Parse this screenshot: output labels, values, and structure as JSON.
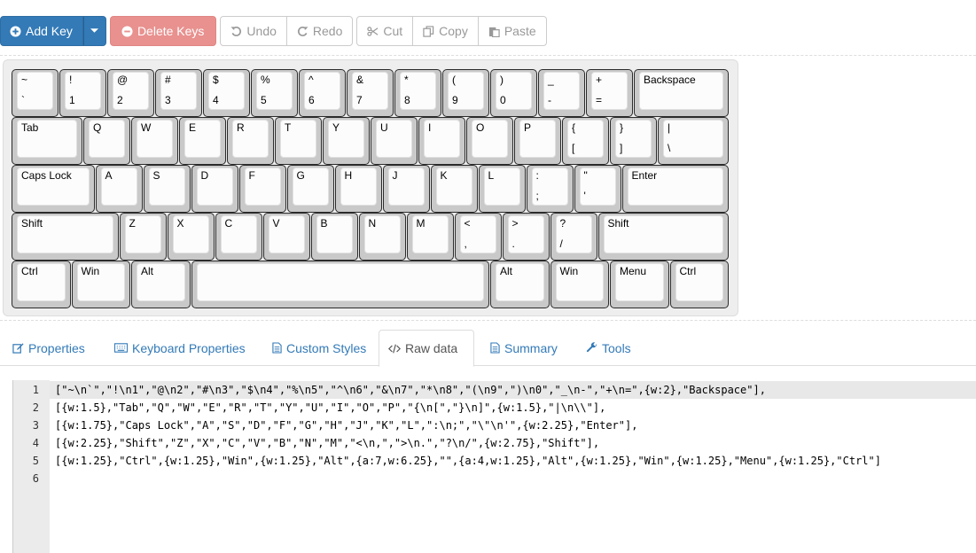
{
  "toolbar": {
    "add_key": "Add Key",
    "delete_keys": "Delete Keys",
    "undo": "Undo",
    "redo": "Redo",
    "cut": "Cut",
    "copy": "Copy",
    "paste": "Paste"
  },
  "keyboard": {
    "rows": [
      [
        [
          "~",
          "`"
        ],
        [
          "!",
          "1"
        ],
        [
          "@",
          "2"
        ],
        [
          "#",
          "3"
        ],
        [
          "$",
          "4"
        ],
        [
          "%",
          "5"
        ],
        [
          "^",
          "6"
        ],
        [
          "&",
          "7"
        ],
        [
          "*",
          "8"
        ],
        [
          "(",
          "9"
        ],
        [
          ")",
          "0"
        ],
        [
          "_",
          "-"
        ],
        [
          "+",
          "="
        ],
        [
          "Backspace",
          ""
        ]
      ],
      [
        [
          "Tab",
          ""
        ],
        [
          "Q",
          ""
        ],
        [
          "W",
          ""
        ],
        [
          "E",
          ""
        ],
        [
          "R",
          ""
        ],
        [
          "T",
          ""
        ],
        [
          "Y",
          ""
        ],
        [
          "U",
          ""
        ],
        [
          "I",
          ""
        ],
        [
          "O",
          ""
        ],
        [
          "P",
          ""
        ],
        [
          "{",
          "["
        ],
        [
          "}",
          "]"
        ],
        [
          "|",
          "\\"
        ]
      ],
      [
        [
          "Caps Lock",
          ""
        ],
        [
          "A",
          ""
        ],
        [
          "S",
          ""
        ],
        [
          "D",
          ""
        ],
        [
          "F",
          ""
        ],
        [
          "G",
          ""
        ],
        [
          "H",
          ""
        ],
        [
          "J",
          ""
        ],
        [
          "K",
          ""
        ],
        [
          "L",
          ""
        ],
        [
          ":",
          ";"
        ],
        [
          "\"",
          "'"
        ],
        [
          "Enter",
          ""
        ]
      ],
      [
        [
          "Shift",
          ""
        ],
        [
          "Z",
          ""
        ],
        [
          "X",
          ""
        ],
        [
          "C",
          ""
        ],
        [
          "V",
          ""
        ],
        [
          "B",
          ""
        ],
        [
          "N",
          ""
        ],
        [
          "M",
          ""
        ],
        [
          "<",
          ","
        ],
        [
          ">",
          "."
        ],
        [
          "?",
          "/"
        ],
        [
          "Shift",
          ""
        ]
      ],
      [
        [
          "Ctrl",
          ""
        ],
        [
          "Win",
          ""
        ],
        [
          "Alt",
          ""
        ],
        [
          "",
          ""
        ],
        [
          "Alt",
          ""
        ],
        [
          "Win",
          ""
        ],
        [
          "Menu",
          ""
        ],
        [
          "Ctrl",
          ""
        ]
      ]
    ]
  },
  "tabs": {
    "properties": "Properties",
    "keyboard_properties": "Keyboard Properties",
    "custom_styles": "Custom Styles",
    "raw_data": "Raw data",
    "summary": "Summary",
    "tools": "Tools"
  },
  "editor": {
    "line_numbers": [
      "1",
      "2",
      "3",
      "4",
      "5",
      "6"
    ],
    "lines": [
      "[\"~\\n`\",\"!\\n1\",\"@\\n2\",\"#\\n3\",\"$\\n4\",\"%\\n5\",\"^\\n6\",\"&\\n7\",\"*\\n8\",\"(\\n9\",\")\\n0\",\"_\\n-\",\"+\\n=\",{w:2},\"Backspace\"],",
      "[{w:1.5},\"Tab\",\"Q\",\"W\",\"E\",\"R\",\"T\",\"Y\",\"U\",\"I\",\"O\",\"P\",\"{\\n[\",\"}\\n]\",{w:1.5},\"|\\n\\\\\"],",
      "[{w:1.75},\"Caps Lock\",\"A\",\"S\",\"D\",\"F\",\"G\",\"H\",\"J\",\"K\",\"L\",\":\\n;\",\"\\\"\\n'\",{w:2.25},\"Enter\"],",
      "[{w:2.25},\"Shift\",\"Z\",\"X\",\"C\",\"V\",\"B\",\"N\",\"M\",\"<\\n,\",\">\\n.\",\"?\\n/\",{w:2.75},\"Shift\"],",
      "[{w:1.25},\"Ctrl\",{w:1.25},\"Win\",{w:1.25},\"Alt\",{a:7,w:6.25},\"\",{a:4,w:1.25},\"Alt\",{w:1.25},\"Win\",{w:1.25},\"Menu\",{w:1.25},\"Ctrl\"]",
      ""
    ]
  }
}
